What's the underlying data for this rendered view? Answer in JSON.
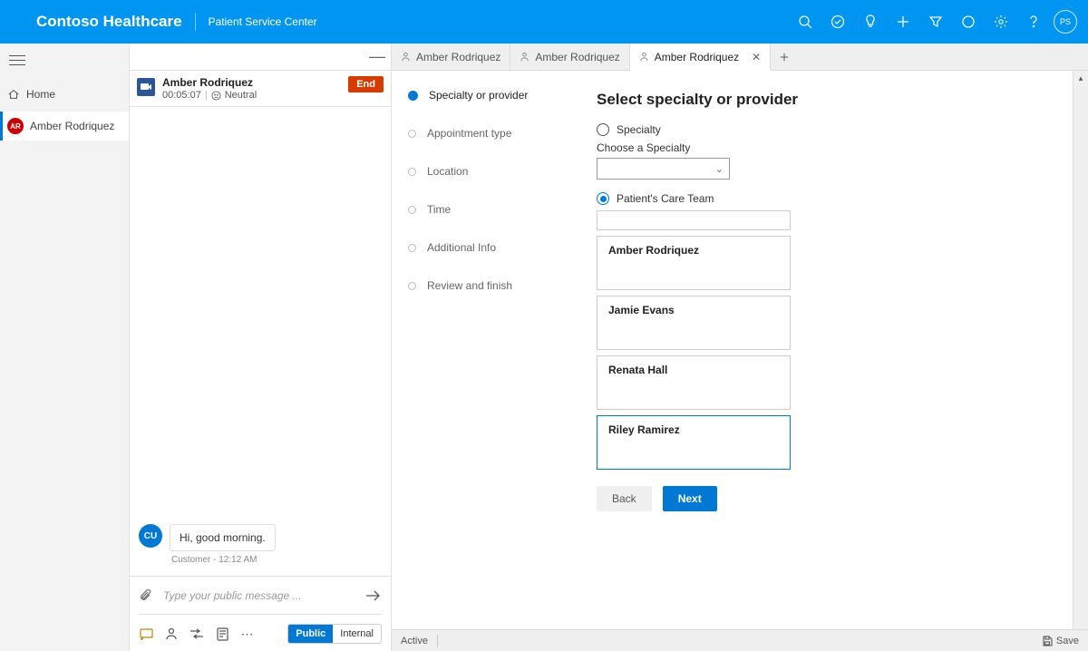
{
  "header": {
    "brand": "Contoso Healthcare",
    "center": "Patient Service Center",
    "user_initials": "PS"
  },
  "sessions": {
    "home": "Home",
    "items": [
      {
        "initials": "AR",
        "label": "Amber Rodriquez"
      }
    ]
  },
  "chat": {
    "name": "Amber Rodriquez",
    "duration": "00:05:07",
    "sentiment": "Neutral",
    "end_label": "End",
    "customer_initials": "CU",
    "message": "Hi, good morning.",
    "meta": "Customer - 12:12 AM",
    "input_placeholder": "Type your public message ...",
    "toggle_public": "Public",
    "toggle_internal": "Internal"
  },
  "tabs": {
    "items": [
      {
        "label": "Amber Rodriquez",
        "active": false
      },
      {
        "label": "Amber Rodriquez",
        "active": false
      },
      {
        "label": "Amber Rodriquez",
        "active": true
      }
    ]
  },
  "stepper": {
    "steps": [
      "Specialty or provider",
      "Appointment type",
      "Location",
      "Time",
      "Additional Info",
      "Review and finish"
    ]
  },
  "form": {
    "title": "Select specialty or provider",
    "radio_specialty": "Specialty",
    "choose_label": "Choose a Specialty",
    "radio_careteam": "Patient's Care Team",
    "care_team": [
      "Amber Rodriquez",
      "Jamie Evans",
      "Renata Hall",
      "Riley Ramirez"
    ],
    "back": "Back",
    "next": "Next"
  },
  "statusbar": {
    "active": "Active",
    "save": "Save"
  }
}
